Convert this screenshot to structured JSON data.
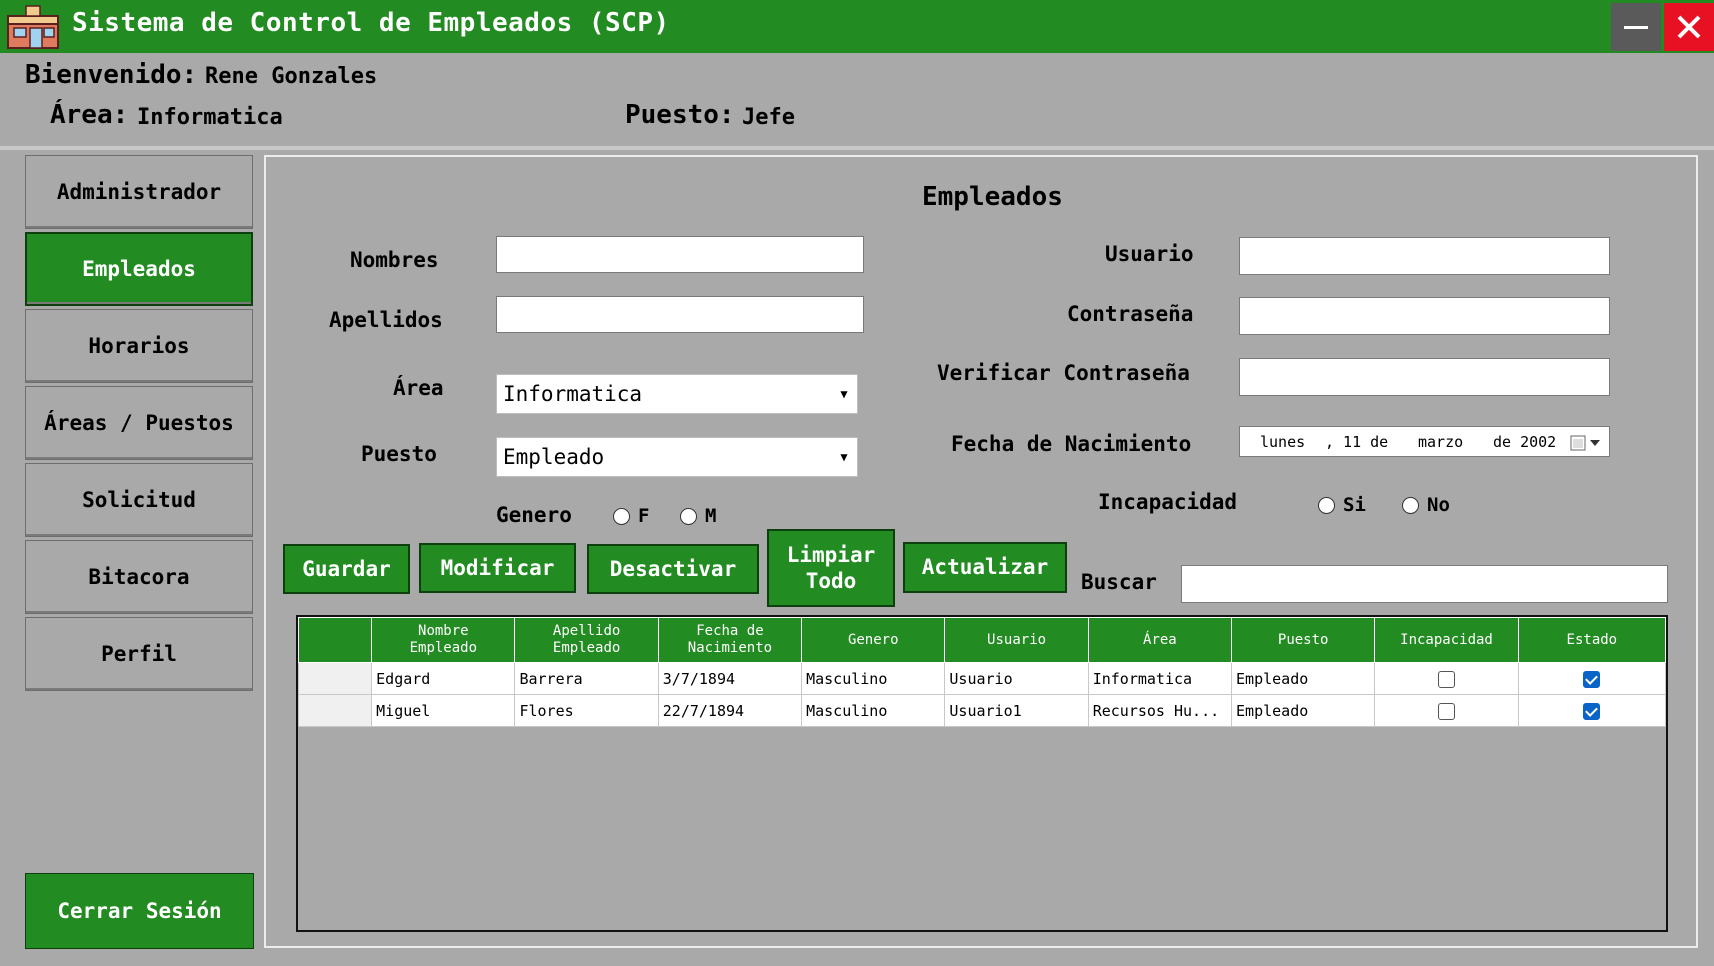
{
  "window": {
    "title": "Sistema de Control de Empleados (SCP)",
    "minimize_icon": "minimize-icon",
    "close_icon": "close-icon"
  },
  "header": {
    "welcome_label": "Bienvenido:",
    "user_name": "Rene Gonzales",
    "area_label": "Área:",
    "area_value": "Informatica",
    "puesto_label": "Puesto:",
    "puesto_value": "Jefe"
  },
  "sidebar": {
    "items": [
      {
        "label": "Administrador"
      },
      {
        "label": "Empleados",
        "active": true
      },
      {
        "label": "Horarios"
      },
      {
        "label": "Áreas / Puestos"
      },
      {
        "label": "Solicitud"
      },
      {
        "label": "Bitacora"
      },
      {
        "label": "Perfil"
      }
    ],
    "logout_label": "Cerrar Sesión"
  },
  "form": {
    "title": "Empleados",
    "nombres_label": "Nombres",
    "nombres_value": "",
    "apellidos_label": "Apellidos",
    "apellidos_value": "",
    "area_label": "Área",
    "area_selected": "Informatica",
    "puesto_label": "Puesto",
    "puesto_selected": "Empleado",
    "genero_label": "Genero",
    "genero_options": [
      "F",
      "M"
    ],
    "usuario_label": "Usuario",
    "usuario_value": "",
    "contrasena_label": "Contraseña",
    "contrasena_value": "",
    "verificar_label": "Verificar Contraseña",
    "verificar_value": "",
    "fecha_label": "Fecha de Nacimiento",
    "fecha_parts": {
      "dia_semana": "lunes",
      "dia": ", 11 de",
      "mes": "marzo",
      "anio": "de 2002"
    },
    "incapacidad_label": "Incapacidad",
    "incapacidad_options": [
      "Si",
      "No"
    ]
  },
  "actions": {
    "guardar": "Guardar",
    "modificar": "Modificar",
    "desactivar": "Desactivar",
    "limpiar_line1": "Limpiar",
    "limpiar_line2": "Todo",
    "actualizar": "Actualizar",
    "buscar_label": "Buscar",
    "buscar_value": ""
  },
  "table": {
    "columns": [
      {
        "line1": "",
        "line2": ""
      },
      {
        "line1": "Nombre",
        "line2": "Empleado"
      },
      {
        "line1": "Apellido",
        "line2": "Empleado"
      },
      {
        "line1": "Fecha de",
        "line2": "Nacimiento"
      },
      {
        "line1": "Genero",
        "line2": ""
      },
      {
        "line1": "Usuario",
        "line2": ""
      },
      {
        "line1": "Área",
        "line2": ""
      },
      {
        "line1": "Puesto",
        "line2": ""
      },
      {
        "line1": "Incapacidad",
        "line2": ""
      },
      {
        "line1": "Estado",
        "line2": ""
      }
    ],
    "rows": [
      {
        "nombre": "Edgard",
        "apellido": "Barrera",
        "fecha": "3/7/1894",
        "genero": "Masculino",
        "usuario": "Usuario",
        "area": "Informatica",
        "puesto": "Empleado",
        "incapacidad": false,
        "estado": true
      },
      {
        "nombre": "Miguel",
        "apellido": "Flores",
        "fecha": "22/7/1894",
        "genero": "Masculino",
        "usuario": "Usuario1",
        "area": "Recursos Hu...",
        "puesto": "Empleado",
        "incapacidad": false,
        "estado": true
      }
    ]
  },
  "colors": {
    "accent": "#228b22",
    "background": "#a9a9a9",
    "close": "#e81123",
    "check": "#0a64c8"
  }
}
